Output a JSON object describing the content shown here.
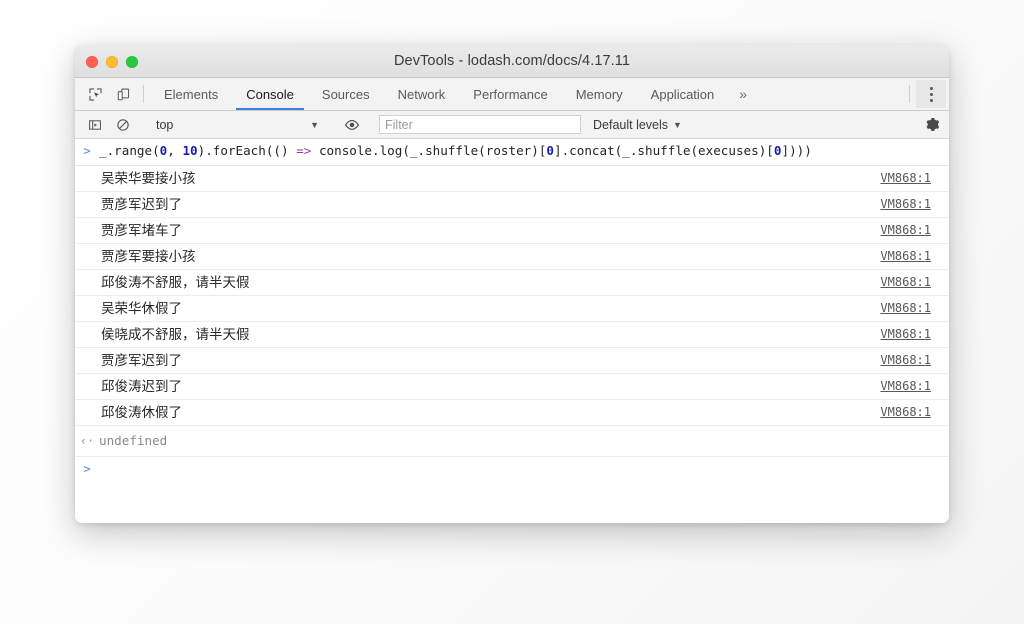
{
  "window": {
    "title": "DevTools - lodash.com/docs/4.17.11",
    "traffic_lights": {
      "close": "close-button",
      "minimize": "minimize-button",
      "zoom": "zoom-button",
      "close_color": "#ff5f57",
      "minimize_color": "#febc2e",
      "zoom_color": "#28c840"
    }
  },
  "tabbar": {
    "inspect_icon": "inspect-element-icon",
    "device_icon": "device-toolbar-icon",
    "tabs": [
      {
        "label": "Elements",
        "active": false
      },
      {
        "label": "Console",
        "active": true
      },
      {
        "label": "Sources",
        "active": false
      },
      {
        "label": "Network",
        "active": false
      },
      {
        "label": "Performance",
        "active": false
      },
      {
        "label": "Memory",
        "active": false
      },
      {
        "label": "Application",
        "active": false
      }
    ],
    "overflow_label": "»",
    "menu_icon": "more-vertical-icon",
    "active_underline_color": "#3c7ddf"
  },
  "console_toolbar": {
    "sidebar_toggle_icon": "console-sidebar-toggle-icon",
    "clear_icon": "clear-console-icon",
    "context_value": "top",
    "context_caret": "▼",
    "eye_icon": "live-expression-eye-icon",
    "filter_placeholder": "Filter",
    "filter_value": "",
    "levels_label": "Default levels",
    "levels_caret": "▼",
    "settings_icon": "settings-gear-icon"
  },
  "console": {
    "prompt_marker": ">",
    "result_marker": "‹·",
    "input_code": {
      "p1": "_.range(",
      "n1": "0",
      "p2": ", ",
      "n2": "10",
      "p3": ").forEach(() ",
      "arrow": "=>",
      "p4": " console.log(_.shuffle(roster)[",
      "n3": "0",
      "p5": "].concat(_.shuffle(execuses)[",
      "n4": "0",
      "p6": "])))"
    },
    "logs": [
      {
        "text": "吴荣华要接小孩",
        "source": "VM868:1"
      },
      {
        "text": "贾彦军迟到了",
        "source": "VM868:1"
      },
      {
        "text": "贾彦军堵车了",
        "source": "VM868:1"
      },
      {
        "text": "贾彦军要接小孩",
        "source": "VM868:1"
      },
      {
        "text": "邱俊涛不舒服，请半天假",
        "source": "VM868:1"
      },
      {
        "text": "吴荣华休假了",
        "source": "VM868:1"
      },
      {
        "text": "侯晓成不舒服，请半天假",
        "source": "VM868:1"
      },
      {
        "text": "贾彦军迟到了",
        "source": "VM868:1"
      },
      {
        "text": "邱俊涛迟到了",
        "source": "VM868:1"
      },
      {
        "text": "邱俊涛休假了",
        "source": "VM868:1"
      }
    ],
    "result_value": "undefined",
    "final_prompt": ">"
  }
}
